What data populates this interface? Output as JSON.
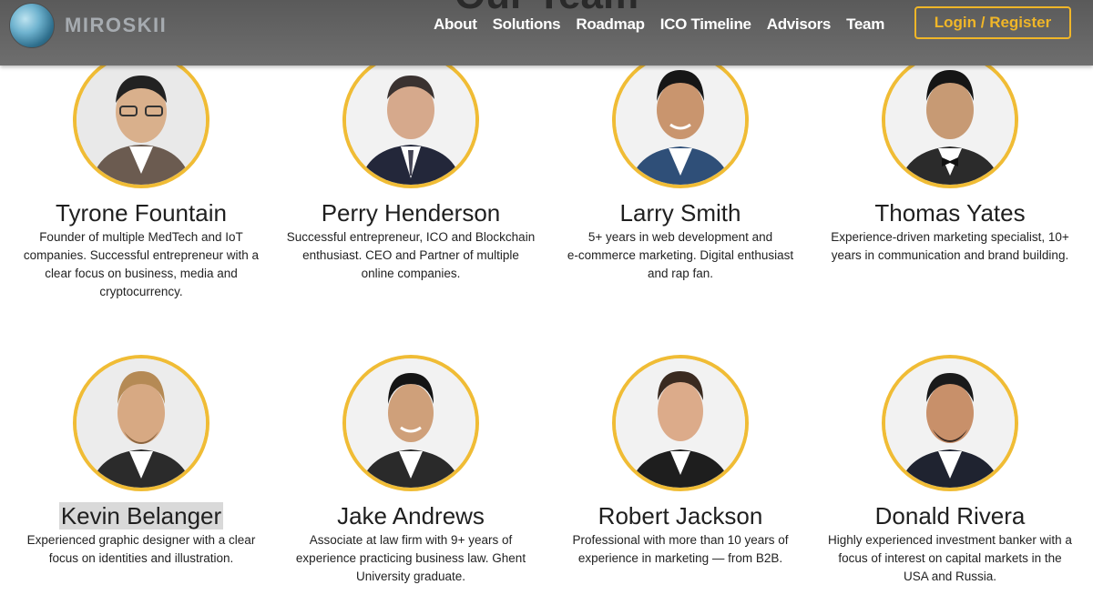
{
  "header": {
    "background_title": "Our Team",
    "logo_text": "MIROSKII",
    "nav": [
      "About",
      "Solutions",
      "Roadmap",
      "ICO Timeline",
      "Advisors",
      "Team"
    ],
    "login_label": "Login / Register"
  },
  "colors": {
    "accent": "#f0bc35",
    "header_bg": "#5f5f5f"
  },
  "team": [
    {
      "name": "Tyrone Fountain",
      "bio": [
        "Founder of multiple MedTech and IoT",
        "companies. Successful entrepreneur with a",
        "clear focus on business, media and",
        "cryptocurrency."
      ]
    },
    {
      "name": "Perry Henderson",
      "bio": [
        "Successful entrepreneur, ICO and Blockchain",
        "enthusiast. CEO and Partner of multiple",
        "online companies."
      ]
    },
    {
      "name": "Larry Smith",
      "bio": [
        "5+ years in web development and",
        "e-commerce marketing. Digital enthusiast",
        "and rap fan."
      ]
    },
    {
      "name": "Thomas Yates",
      "bio": [
        "Experience-driven marketing specialist, 10+",
        "years in communication and brand building."
      ]
    },
    {
      "name": "Kevin Belanger",
      "bio": [
        "Experienced graphic designer with a clear",
        "focus on identities and illustration."
      ]
    },
    {
      "name": "Jake Andrews",
      "bio": [
        "Associate at law firm with 9+ years of",
        "experience practicing business law. Ghent",
        "University graduate."
      ]
    },
    {
      "name": "Robert Jackson",
      "bio": [
        "Professional with more than 10 years of",
        "experience in marketing — from B2B."
      ]
    },
    {
      "name": "Donald Rivera",
      "bio": [
        "Highly experienced investment banker with a",
        "focus of interest on capital markets in the",
        "USA and Russia."
      ]
    }
  ]
}
